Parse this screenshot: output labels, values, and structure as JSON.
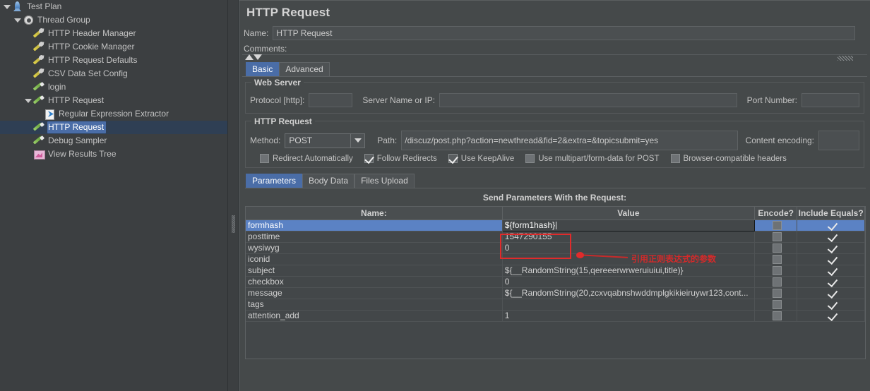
{
  "tree": {
    "items": [
      {
        "label": "Test Plan",
        "indent": 0,
        "icon": "testplan-icon",
        "toggle": "expanded",
        "selected": false
      },
      {
        "label": "Thread Group",
        "indent": 1,
        "icon": "gear-icon",
        "toggle": "expanded",
        "selected": false
      },
      {
        "label": "HTTP Header Manager",
        "indent": 2,
        "icon": "config-icon",
        "toggle": "none",
        "selected": false
      },
      {
        "label": "HTTP Cookie Manager",
        "indent": 2,
        "icon": "config-icon",
        "toggle": "none",
        "selected": false
      },
      {
        "label": "HTTP Request Defaults",
        "indent": 2,
        "icon": "config-icon",
        "toggle": "none",
        "selected": false
      },
      {
        "label": "CSV Data Set Config",
        "indent": 2,
        "icon": "config-icon",
        "toggle": "none",
        "selected": false
      },
      {
        "label": "login",
        "indent": 2,
        "icon": "sampler-icon",
        "toggle": "none",
        "selected": false
      },
      {
        "label": "HTTP Request",
        "indent": 2,
        "icon": "sampler-icon",
        "toggle": "expanded",
        "selected": false
      },
      {
        "label": "Regular Expression Extractor",
        "indent": 3,
        "icon": "postproc-icon",
        "toggle": "none",
        "selected": false
      },
      {
        "label": "HTTP Request",
        "indent": 2,
        "icon": "sampler-icon",
        "toggle": "none",
        "selected": true
      },
      {
        "label": "Debug Sampler",
        "indent": 2,
        "icon": "sampler-icon",
        "toggle": "none",
        "selected": false
      },
      {
        "label": "View Results Tree",
        "indent": 2,
        "icon": "listener-icon",
        "toggle": "none",
        "selected": false
      }
    ]
  },
  "main": {
    "title": "HTTP Request",
    "name_label": "Name:",
    "name_value": "HTTP Request",
    "comments_label": "Comments:",
    "comments_value": "",
    "tabs": [
      {
        "label": "Basic",
        "active": true
      },
      {
        "label": "Advanced",
        "active": false
      }
    ],
    "web_server": {
      "group_title": "Web Server",
      "protocol_label": "Protocol [http]:",
      "protocol_value": "",
      "server_label": "Server Name or IP:",
      "server_value": "",
      "port_label": "Port Number:",
      "port_value": ""
    },
    "http_request": {
      "group_title": "HTTP Request",
      "method_label": "Method:",
      "method_value": "POST",
      "path_label": "Path:",
      "path_value": "/discuz/post.php?action=newthread&fid=2&extra=&topicsubmit=yes",
      "encoding_label": "Content encoding:",
      "encoding_value": ""
    },
    "checkboxes": [
      {
        "label": "Redirect Automatically",
        "checked": false
      },
      {
        "label": "Follow Redirects",
        "checked": true
      },
      {
        "label": "Use KeepAlive",
        "checked": true
      },
      {
        "label": "Use multipart/form-data for POST",
        "checked": false
      },
      {
        "label": "Browser-compatible headers",
        "checked": false
      }
    ],
    "subtabs": [
      {
        "label": "Parameters",
        "active": true
      },
      {
        "label": "Body Data",
        "active": false
      },
      {
        "label": "Files Upload",
        "active": false
      }
    ],
    "params_title": "Send Parameters With the Request:",
    "table": {
      "columns": [
        "Name:",
        "Value",
        "Encode?",
        "Include Equals?"
      ],
      "rows": [
        {
          "name": "formhash",
          "value": "${form1hash}",
          "encode": false,
          "include_equals": true,
          "selected": true,
          "editing": true
        },
        {
          "name": "posttime",
          "value": "1547290155",
          "encode": false,
          "include_equals": true,
          "selected": false,
          "editing": false
        },
        {
          "name": "wysiwyg",
          "value": "0",
          "encode": false,
          "include_equals": true,
          "selected": false,
          "editing": false
        },
        {
          "name": "iconid",
          "value": "",
          "encode": false,
          "include_equals": true,
          "selected": false,
          "editing": false
        },
        {
          "name": "subject",
          "value": "${__RandomString(15,qereeerwrweruiuiui,title)}",
          "encode": false,
          "include_equals": true,
          "selected": false,
          "editing": false
        },
        {
          "name": "checkbox",
          "value": "0",
          "encode": false,
          "include_equals": true,
          "selected": false,
          "editing": false
        },
        {
          "name": "message",
          "value": "${__RandomString(20,zcxvqabnshwddmplgkikieiruywr123,cont...",
          "encode": false,
          "include_equals": true,
          "selected": false,
          "editing": false
        },
        {
          "name": "tags",
          "value": "",
          "encode": false,
          "include_equals": true,
          "selected": false,
          "editing": false
        },
        {
          "name": "attention_add",
          "value": "1",
          "encode": false,
          "include_equals": true,
          "selected": false,
          "editing": false
        }
      ]
    }
  },
  "annotation": {
    "text": "引用正则表达式的参数",
    "color": "#d42a2a"
  }
}
